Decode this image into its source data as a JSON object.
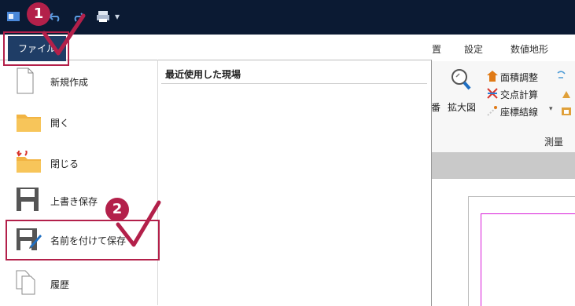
{
  "title_bar": {
    "quick_access": [
      "undo",
      "redo",
      "print",
      "customize"
    ]
  },
  "ribbon": {
    "tabs": [
      "置",
      "設定",
      "数値地形"
    ],
    "items": {
      "zoom_label": "拡大図",
      "number_label": "番",
      "area_adjust": "面積調整",
      "intersection_calc": "交点計算",
      "coord_connect": "座標結線"
    },
    "group_label": "測量"
  },
  "file_tab": {
    "label": "ファイル"
  },
  "backstage": {
    "menu": [
      {
        "label": "新規作成",
        "icon": "new-doc-icon"
      },
      {
        "label": "開く",
        "icon": "open-folder-icon"
      },
      {
        "label": "閉じる",
        "icon": "close-folder-icon"
      },
      {
        "label": "上書き保存",
        "icon": "save-icon"
      },
      {
        "label": "名前を付けて保存",
        "icon": "save-as-icon"
      },
      {
        "label": "履歴",
        "icon": "history-icon"
      }
    ],
    "recent_title": "最近使用した現場"
  },
  "annotations": {
    "badge1": "1",
    "badge2": "2"
  },
  "colors": {
    "accent": "#b3204a",
    "file_tab": "#1f3d66",
    "titlebar": "#0b1a33"
  }
}
